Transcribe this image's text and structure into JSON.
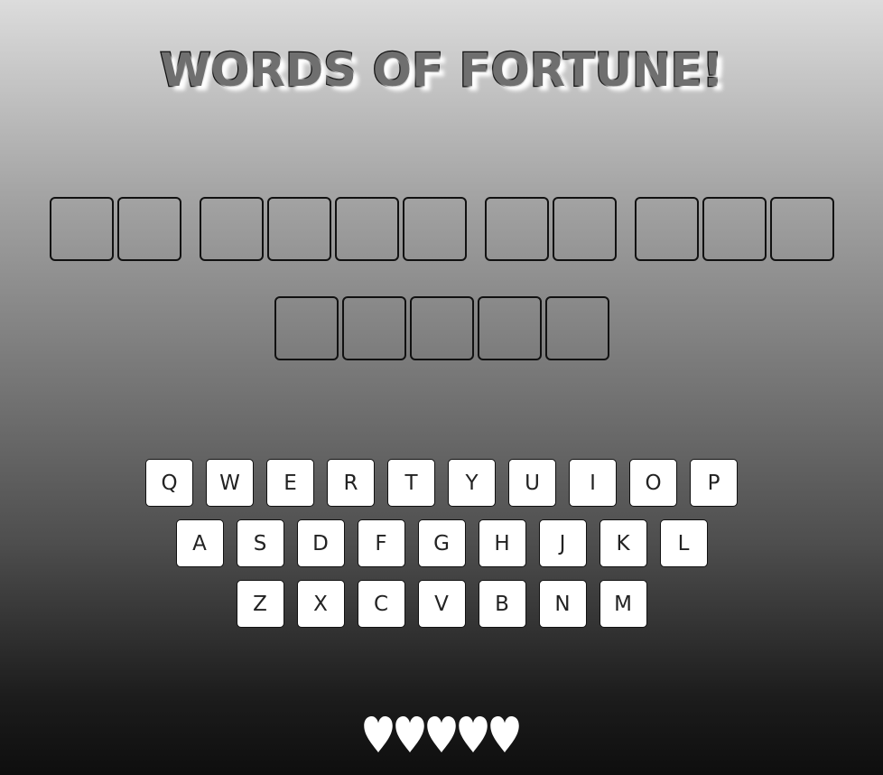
{
  "game": {
    "title": "WORDS OF FORTUNE!"
  },
  "puzzle": {
    "lines": [
      [
        [
          "",
          ""
        ],
        [
          "",
          "",
          "",
          ""
        ],
        [
          "",
          ""
        ],
        [
          "",
          "",
          ""
        ]
      ],
      [
        [
          "",
          "",
          "",
          "",
          ""
        ]
      ]
    ]
  },
  "keyboard": {
    "rows": [
      [
        "Q",
        "W",
        "E",
        "R",
        "T",
        "Y",
        "U",
        "I",
        "O",
        "P"
      ],
      [
        "A",
        "S",
        "D",
        "F",
        "G",
        "H",
        "J",
        "K",
        "L"
      ],
      [
        "Z",
        "X",
        "C",
        "V",
        "B",
        "N",
        "M"
      ]
    ]
  },
  "lives": {
    "remaining": 5,
    "icon": "heart-icon",
    "color": "#ffffff"
  }
}
